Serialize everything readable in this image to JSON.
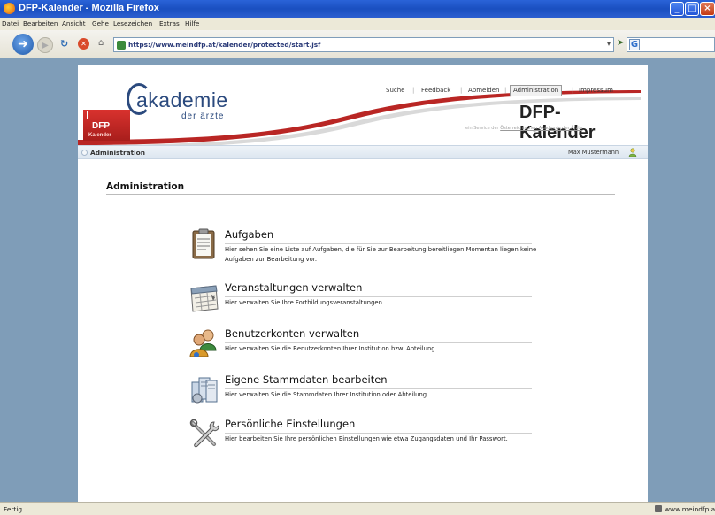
{
  "window": {
    "title": "DFP-Kalender - Mozilla Firefox"
  },
  "menubar": [
    "Datei",
    "Bearbeiten",
    "Ansicht",
    "Gehe",
    "Lesezeichen",
    "Extras",
    "Hilfe"
  ],
  "navbar": {
    "url": "https://www.meindfp.at/kalender/protected/start.jsf",
    "search_icon_letter": "G"
  },
  "statusbar": {
    "status": "Fertig",
    "host": "www.meindfp.at"
  },
  "header": {
    "logo_text": "akademie",
    "logo_sub": "der ärzte",
    "badge_big": "DFP",
    "badge_small": "Kalender",
    "nav": [
      "Suche",
      "Feedback",
      "Abmelden",
      "Administration",
      "Impressum"
    ],
    "active_nav": "Administration",
    "brand": "DFP-Kalender",
    "brand_sub_prefix": "ein Service der ",
    "brand_sub_link": "Österreichischen Akademie der Ärzte"
  },
  "crumbbar": {
    "crumb": "Administration",
    "user": "Max Mustermann"
  },
  "main": {
    "title": "Administration",
    "entries": [
      {
        "icon": "clipboard-icon",
        "heading": "Aufgaben",
        "desc": "Hier sehen Sie eine Liste auf Aufgaben, die für Sie zur Bearbeitung bereitliegen.Momentan liegen keine Aufgaben zur Bearbeitung vor."
      },
      {
        "icon": "calendar-icon",
        "heading": "Veranstaltungen verwalten",
        "desc": "Hier verwalten Sie Ihre Fortbildungsveranstaltungen."
      },
      {
        "icon": "users-icon",
        "heading": "Benutzerkonten verwalten",
        "desc": "Hier verwalten Sie die Benutzerkonten Ihrer Institution bzw. Abteilung."
      },
      {
        "icon": "files-icon",
        "heading": "Eigene Stammdaten bearbeiten",
        "desc": "Hier verwalten Sie die Stammdaten Ihrer Institution oder Abteilung."
      },
      {
        "icon": "tools-icon",
        "heading": "Persönliche Einstellungen",
        "desc": "Hier bearbeiten Sie Ihre persönlichen Einstellungen wie etwa Zugangsdaten und Ihr Passwort."
      }
    ]
  }
}
